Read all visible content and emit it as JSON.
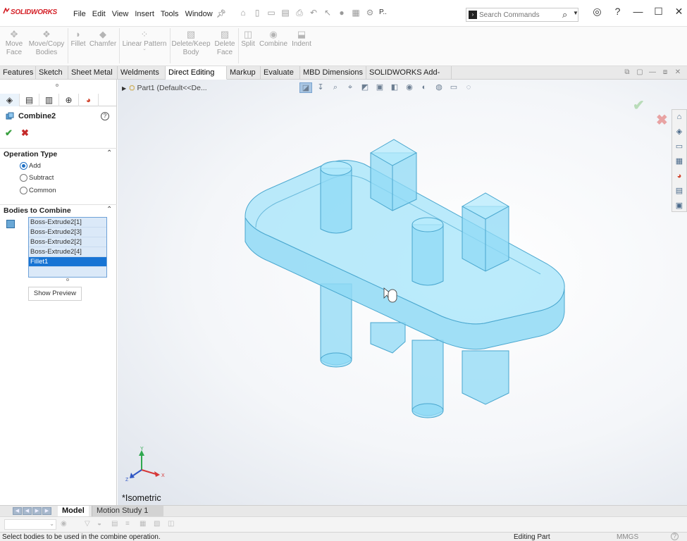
{
  "app": {
    "logo": "SOLIDWORKS"
  },
  "menu": {
    "items": [
      "File",
      "Edit",
      "View",
      "Insert",
      "Tools",
      "Window"
    ]
  },
  "qat": {
    "truncated_label": "P.."
  },
  "search": {
    "placeholder": "Search Commands"
  },
  "commands": [
    {
      "label1": "Move",
      "label2": "Face",
      "icon": "move-face-icon"
    },
    {
      "label1": "Move/Copy",
      "label2": "Bodies",
      "icon": "move-copy-bodies-icon"
    },
    {
      "label1": "Fillet",
      "label2": "",
      "icon": "fillet-icon"
    },
    {
      "label1": "Chamfer",
      "label2": "",
      "icon": "chamfer-icon"
    },
    {
      "label1": "Linear Pattern",
      "label2": "",
      "icon": "linear-pattern-icon"
    },
    {
      "label1": "Delete/Keep",
      "label2": "Body",
      "icon": "delete-keep-body-icon"
    },
    {
      "label1": "Delete",
      "label2": "Face",
      "icon": "delete-face-icon"
    },
    {
      "label1": "Split",
      "label2": "",
      "icon": "split-icon"
    },
    {
      "label1": "Combine",
      "label2": "",
      "icon": "combine-icon"
    },
    {
      "label1": "Indent",
      "label2": "",
      "icon": "indent-icon"
    }
  ],
  "tabs": [
    "Features",
    "Sketch",
    "Sheet Metal",
    "Weldments",
    "Direct Editing",
    "Markup",
    "Evaluate",
    "MBD Dimensions",
    "SOLIDWORKS Add-Ins"
  ],
  "active_tab": "Direct Editing",
  "property_manager": {
    "title": "Combine2",
    "operation_type": {
      "title": "Operation Type",
      "options": [
        "Add",
        "Subtract",
        "Common"
      ],
      "selected": "Add"
    },
    "bodies": {
      "title": "Bodies to Combine",
      "items": [
        "Boss-Extrude2[1]",
        "Boss-Extrude2[3]",
        "Boss-Extrude2[2]",
        "Boss-Extrude2[4]",
        "Fillet1"
      ],
      "selected": "Fillet1"
    },
    "show_preview": "Show Preview"
  },
  "viewport": {
    "tree_label": "Part1  (Default<<De...",
    "view_name": "*Isometric",
    "triad": {
      "x": "X",
      "y": "Y",
      "z": "Z"
    },
    "model_color": "#8fd9f5"
  },
  "bottom_tabs": [
    "Model",
    "Motion Study 1"
  ],
  "status": {
    "message": "Select bodies to be used in the combine operation.",
    "mode": "Editing Part",
    "units": "MMGS"
  }
}
